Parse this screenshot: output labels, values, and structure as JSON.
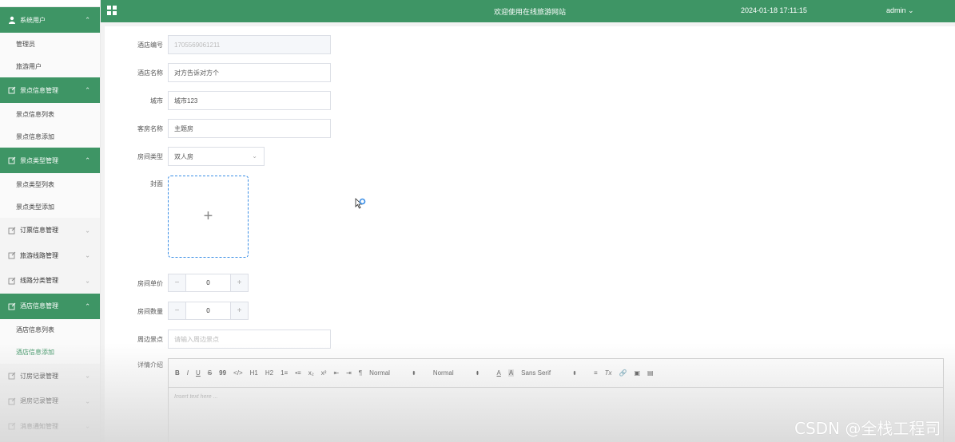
{
  "sidebar": {
    "groups": [
      {
        "label": "系统用户",
        "open": true,
        "items": [
          "管理员",
          "旅游用户"
        ]
      },
      {
        "label": "景点信息管理",
        "open": true,
        "items": [
          "景点信息列表",
          "景点信息添加"
        ]
      },
      {
        "label": "景点类型管理",
        "open": true,
        "items": [
          "景点类型列表",
          "景点类型添加"
        ]
      },
      {
        "label": "订票信息管理",
        "open": false,
        "items": []
      },
      {
        "label": "旅游线路管理",
        "open": false,
        "items": []
      },
      {
        "label": "线路分类管理",
        "open": false,
        "items": []
      },
      {
        "label": "酒店信息管理",
        "open": true,
        "items": [
          "酒店信息列表",
          "酒店信息添加"
        ]
      },
      {
        "label": "订房记录管理",
        "open": false,
        "items": []
      },
      {
        "label": "退房记录管理",
        "open": false,
        "items": []
      },
      {
        "label": "消息通知管理",
        "open": false,
        "items": []
      }
    ],
    "active_item": "酒店信息添加"
  },
  "topbar": {
    "welcome": "欢迎使用在线旅游网站",
    "datetime": "2024-01-18 17:11:15",
    "user": "admin",
    "user_caret": "⌄"
  },
  "form": {
    "hotel_no_label": "酒店编号",
    "hotel_no_value": "1705569061211",
    "hotel_name_label": "酒店名称",
    "hotel_name_value": "对方告诉对方个",
    "city_label": "城市",
    "city_value": "城市123",
    "room_name_label": "客房名称",
    "room_name_value": "主题房",
    "room_type_label": "房间类型",
    "room_type_value": "双人房",
    "cover_label": "封面",
    "upload_plus": "+",
    "price_label": "房间单价",
    "price_value": "0",
    "qty_label": "房间数量",
    "qty_value": "0",
    "stepper_minus": "−",
    "stepper_plus": "+",
    "nearby_label": "周边景点",
    "nearby_placeholder": "请输入周边景点",
    "detail_label": "详情介绍"
  },
  "editor": {
    "tools": [
      "B",
      "I",
      "U",
      "S",
      "99",
      "</>",
      "H1",
      "H2",
      "1≡",
      "•≡",
      "x₂",
      "x²",
      "⇤",
      "⇥",
      "¶"
    ],
    "size_select": "Normal",
    "heading_select": "Normal",
    "font_select": "Sans Serif",
    "tools_after": [
      "A",
      "A",
      "≡",
      "Tx",
      "🔗",
      "▣",
      "▤"
    ],
    "placeholder": "Insert text here ..."
  },
  "watermark": "CSDN @全栈工程司",
  "colors": {
    "primary": "#3e9565",
    "upload_border": "#3a8ee6"
  }
}
